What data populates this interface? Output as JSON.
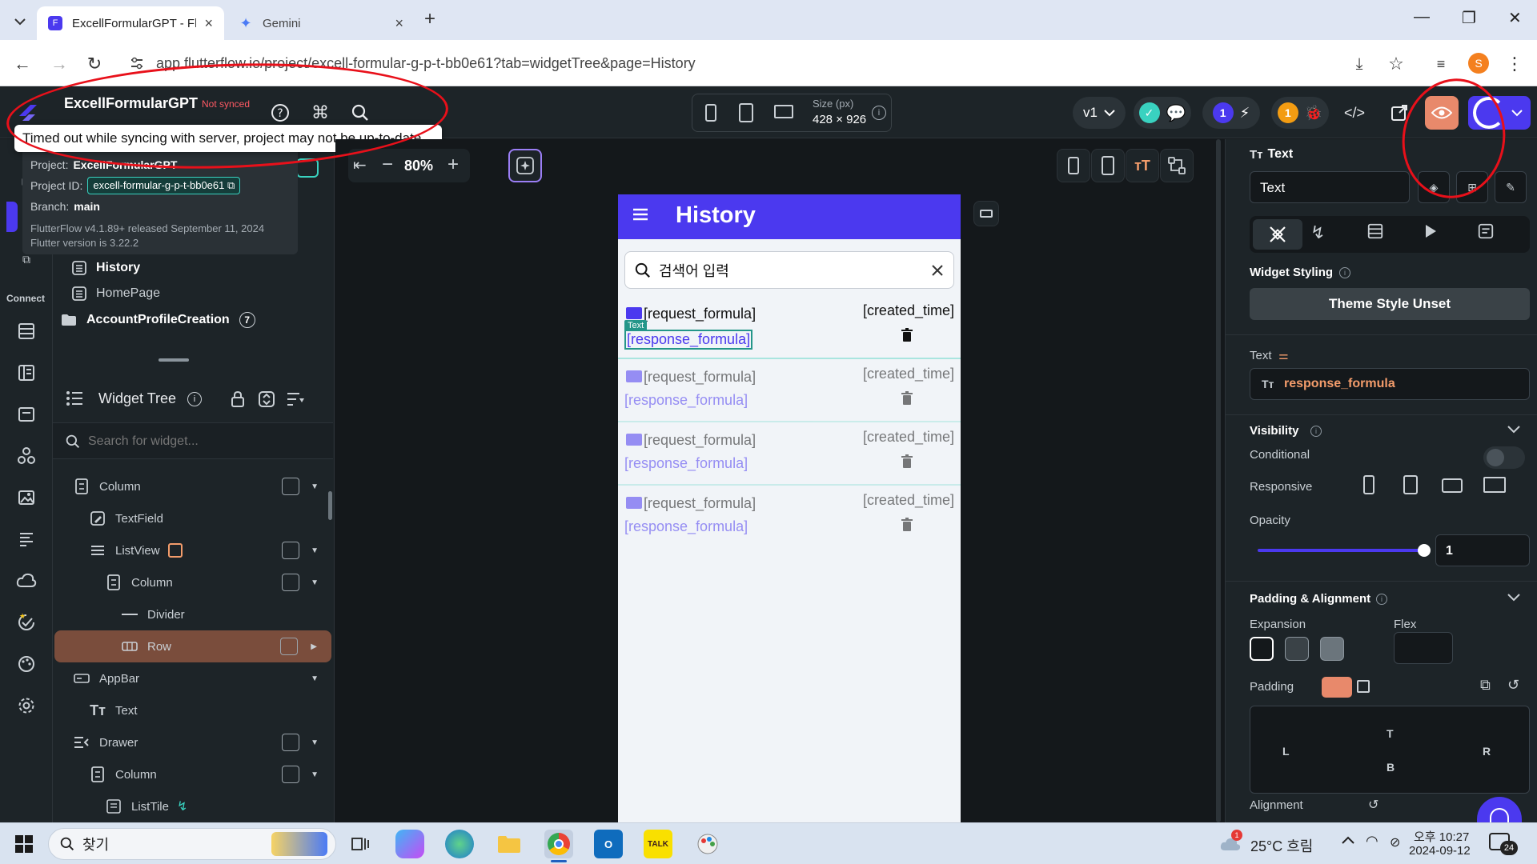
{
  "browser": {
    "tabs": [
      {
        "title": "ExcellFormularGPT - FlutterFlow",
        "active": true
      },
      {
        "title": "Gemini",
        "active": false
      }
    ],
    "url": "app.flutterflow.io/project/excell-formular-g-p-t-bb0e61?tab=widgetTree&page=History",
    "profile_initial": "S"
  },
  "topbar": {
    "project_name": "ExcellFormularGPT",
    "sync_status": "Not synced",
    "size_label": "Size (px)",
    "size_value": "428 × 926",
    "version": "v1",
    "badge_a": "1",
    "badge_b": "1"
  },
  "sync_tooltip": "Timed out while syncing with server, project may not be up-to-date",
  "project_info": {
    "project_label": "Project:",
    "project_value": "ExcellFormularGPT",
    "id_label": "Project ID:",
    "id_value": "excell-formular-g-p-t-bb0e61",
    "branch_label": "Branch:",
    "branch_value": "main",
    "release": "FlutterFlow v4.1.89+ released September 11, 2024",
    "flutter": "Flutter version is 3.22.2"
  },
  "rail": {
    "connect_label": "Connect"
  },
  "pages": {
    "items": [
      "History",
      "HomePage"
    ],
    "folder": "AccountProfileCreation",
    "folder_count": "7"
  },
  "widget_tree": {
    "title": "Widget Tree",
    "search_placeholder": "Search for widget...",
    "rows": [
      "Column",
      "TextField",
      "ListView",
      "Column",
      "Divider",
      "Row",
      "AppBar",
      "Text",
      "Drawer",
      "Column",
      "ListTile"
    ]
  },
  "canvas": {
    "zoom": "80%",
    "page_title": "History",
    "search_placeholder": "검색어 입력",
    "text_badge": "Text",
    "items": [
      {
        "request": "[request_formula]",
        "response": "[response_formula]",
        "created": "[created_time]"
      },
      {
        "request": "[request_formula]",
        "response": "[response_formula]",
        "created": "[created_time]"
      },
      {
        "request": "[request_formula]",
        "response": "[response_formula]",
        "created": "[created_time]"
      },
      {
        "request": "[request_formula]",
        "response": "[response_formula]",
        "created": "[created_time]"
      }
    ]
  },
  "properties": {
    "widget_type": "Text",
    "widget_name": "Text",
    "widget_styling": "Widget Styling",
    "theme_style": "Theme Style Unset",
    "text_label": "Text",
    "text_value": "response_formula",
    "visibility": "Visibility",
    "conditional": "Conditional",
    "responsive": "Responsive",
    "opacity_label": "Opacity",
    "opacity_value": "1",
    "opacity": 1,
    "padding_alignment": "Padding & Alignment",
    "expansion": "Expansion",
    "flex": "Flex",
    "padding": "Padding",
    "pad_t": "T",
    "pad_l": "L",
    "pad_r": "R",
    "pad_b": "B",
    "alignment": "Alignment"
  },
  "taskbar": {
    "search_text": "찾기",
    "weather": "25°C 흐림",
    "time_period": "오후 10:27",
    "date": "2024-09-12",
    "notif_count": "24",
    "weather_alert": "1",
    "kakao": "TALK"
  },
  "colors": {
    "primary": "#4b39ef",
    "accent": "#39d2c0",
    "error": "#ff5963",
    "selected_row": "#7a4d3c",
    "annotation": "#e8101a"
  }
}
